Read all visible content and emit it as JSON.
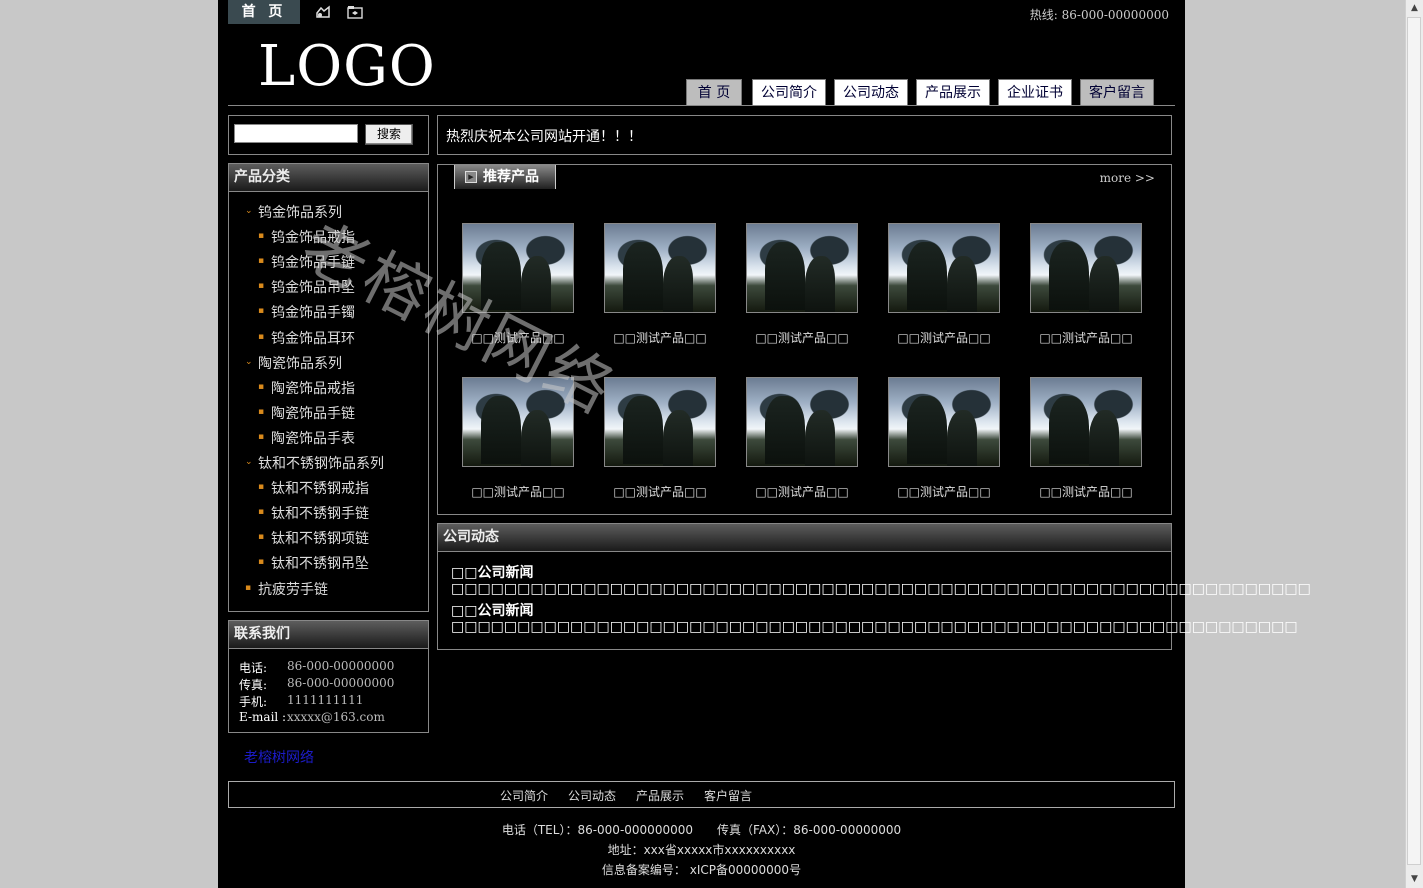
{
  "top": {
    "home_tab": "首 页",
    "hotline": "热线: 86-000-00000000",
    "icons": [
      "bookmark-icon",
      "folder-icon"
    ]
  },
  "logo": "LOGO",
  "nav": [
    {
      "label": "首 页",
      "muted": true
    },
    {
      "label": "公司简介",
      "muted": false
    },
    {
      "label": "公司动态",
      "muted": false
    },
    {
      "label": "产品展示",
      "muted": false
    },
    {
      "label": "企业证书",
      "muted": false
    },
    {
      "label": "客户留言",
      "muted": true
    }
  ],
  "search": {
    "button": "搜索",
    "value": ""
  },
  "announcement": "热烈庆祝本公司网站开通！！！",
  "categories": {
    "title": "产品分类",
    "items": [
      {
        "label": "钨金饰品系列",
        "level": 0
      },
      {
        "label": "钨金饰品戒指",
        "level": 1
      },
      {
        "label": "钨金饰品手链",
        "level": 1
      },
      {
        "label": "钨金饰品吊坠",
        "level": 1
      },
      {
        "label": "钨金饰品手镯",
        "level": 1
      },
      {
        "label": "钨金饰品耳环",
        "level": 1
      },
      {
        "label": "陶瓷饰品系列",
        "level": 0
      },
      {
        "label": "陶瓷饰品戒指",
        "level": 1
      },
      {
        "label": "陶瓷饰品手链",
        "level": 1
      },
      {
        "label": "陶瓷饰品手表",
        "level": 1
      },
      {
        "label": "钛和不锈钢饰品系列",
        "level": 0
      },
      {
        "label": "钛和不锈钢戒指",
        "level": 1
      },
      {
        "label": "钛和不锈钢手链",
        "level": 1
      },
      {
        "label": "钛和不锈钢项链",
        "level": 1
      },
      {
        "label": "钛和不锈钢吊坠",
        "level": 1
      },
      {
        "label": "抗疲劳手链",
        "level": 2
      }
    ]
  },
  "recommended": {
    "title": "推荐产品",
    "more": "more >>",
    "products": [
      "□□测试产品□□",
      "□□测试产品□□",
      "□□测试产品□□",
      "□□测试产品□□",
      "□□测试产品□□",
      "□□测试产品□□",
      "□□测试产品□□",
      "□□测试产品□□",
      "□□测试产品□□",
      "□□测试产品□□"
    ]
  },
  "news": {
    "title": "公司动态",
    "items": [
      "□□公司新闻□□□□□□□□□□□□□□□□□□□□□□□□□□□□□□□□□□□□□□□□□□□□□□□□□□□□□□□□□□□□□□□□□",
      "□□公司新闻□□□□□□□□□□□□□□□□□□□□□□□□□□□□□□□□□□□□□□□□□□□□□□□□□□□□□□□□□□□□□□□□"
    ]
  },
  "contact": {
    "title": "联系我们",
    "rows": [
      {
        "label": "电话:",
        "value": "86-000-00000000"
      },
      {
        "label": "传真:",
        "value": "86-000-00000000"
      },
      {
        "label": "手机:",
        "value": "1111111111"
      },
      {
        "label": "E-mail :",
        "value": "xxxxx@163.com"
      }
    ]
  },
  "friend_link": "老榕树网络",
  "footer": {
    "links": [
      "公司简介",
      "公司动态",
      "产品展示",
      "客户留言"
    ],
    "phone": "电话（TEL）：86-000-000000000　　传真（FAX）：86-000-00000000",
    "address": "地址：xxx省xxxxx市xxxxxxxxxx",
    "icp": "信息备案编号： xICP备00000000号"
  },
  "watermark": "老榕树网络"
}
